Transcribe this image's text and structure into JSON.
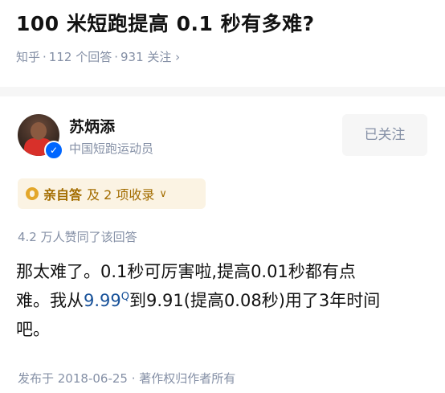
{
  "question": {
    "title": "100 米短跑提高 0.1 秒有多难?",
    "source": "知乎",
    "answer_count": "112 个回答",
    "follower_count": "931 关注",
    "chevron": "›"
  },
  "author": {
    "name": "苏炳添",
    "bio": "中国短跑运动员",
    "verified_mark": "✓",
    "follow_label": "已关注"
  },
  "tag": {
    "label": "亲自答",
    "more": "及 2 项收录",
    "chevron": "∨"
  },
  "votes": {
    "text": "4.2 万人赞同了该回答"
  },
  "answer": {
    "line1": "那太难了。0.1秒可厉害啦,提高0.01秒都有点",
    "line2_pre": "难。我从",
    "line2_link": "9.99",
    "line2_cite": "Q",
    "line2_post": "到9.91(提高0.08秒)用了3年时间",
    "line3": "吧。"
  },
  "publish": {
    "text": "发布于 2018-06-25 · 著作权归作者所有"
  },
  "colors": {
    "muted": "#8590a6",
    "link": "#175199",
    "tag_bg": "#fbf3e3",
    "tag_text": "#a36d00",
    "badge": "#0066ff"
  }
}
